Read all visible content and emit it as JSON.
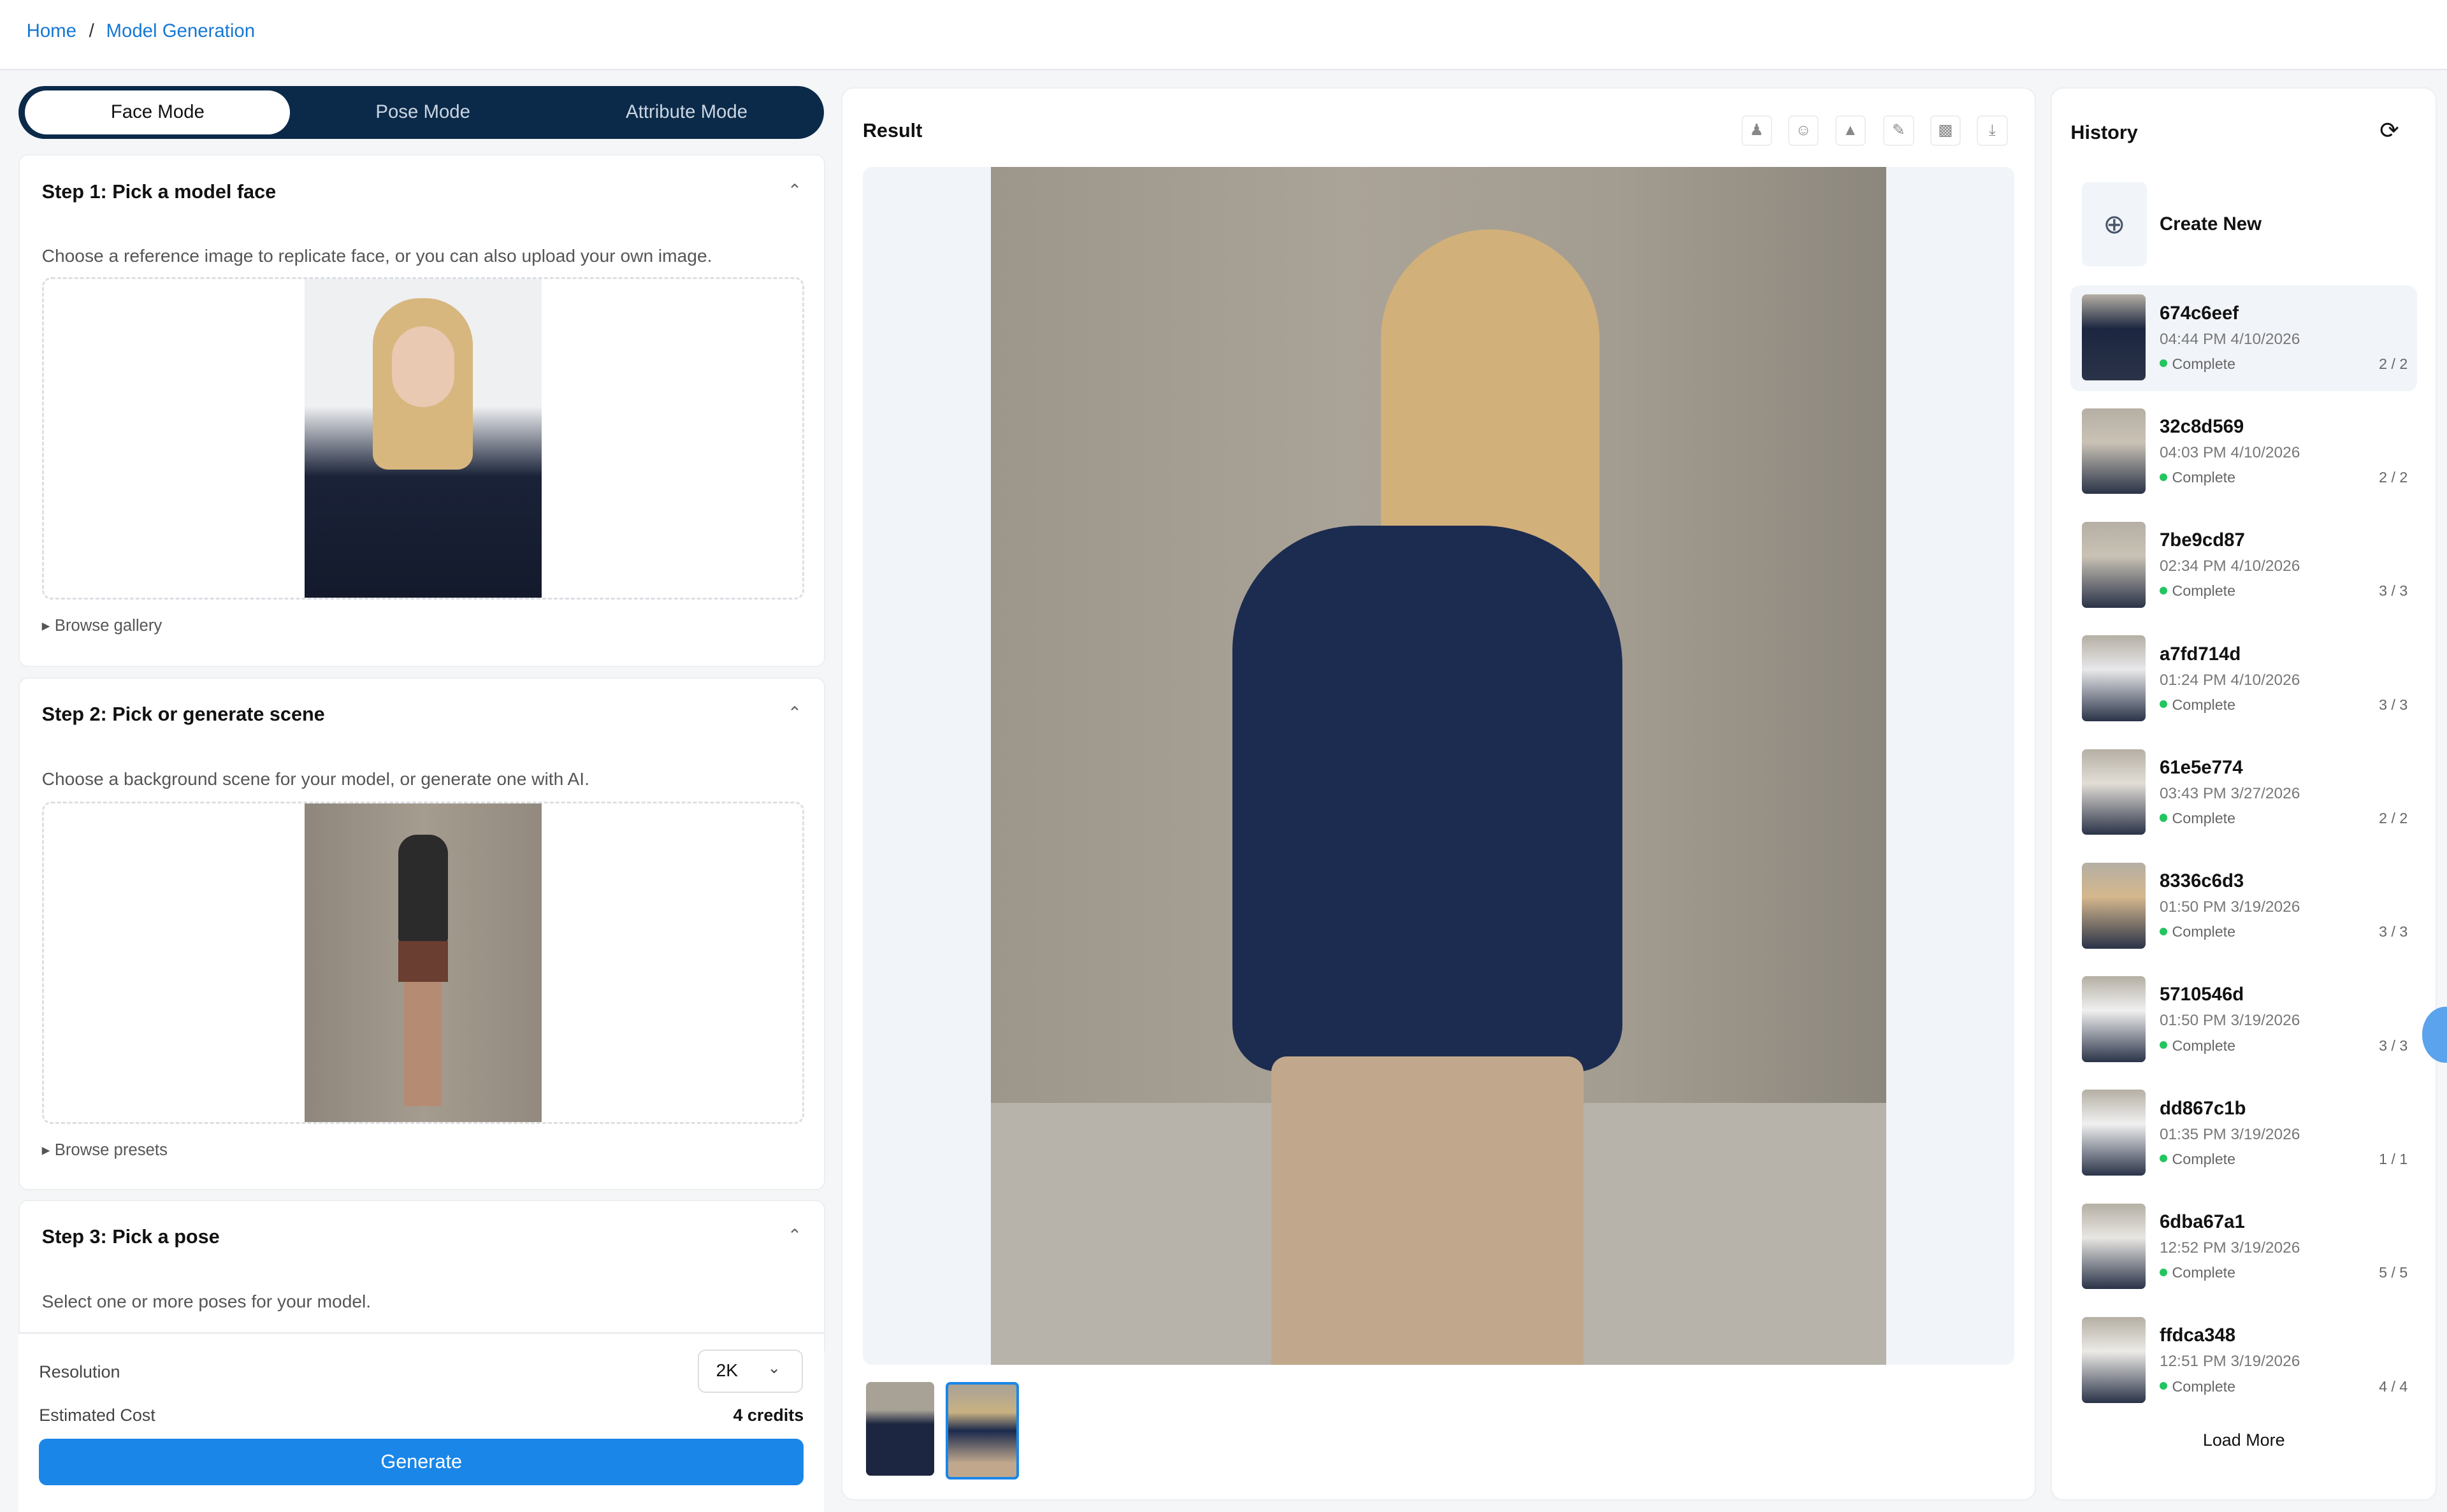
{
  "breadcrumb": {
    "home": "Home",
    "separator": "/",
    "current": "Model Generation"
  },
  "modes": [
    "Face Mode",
    "Pose Mode",
    "Attribute Mode"
  ],
  "steps": [
    {
      "title": "Step 1: Pick a model face",
      "desc": "Choose a reference image to replicate face, or you can also upload your own image.",
      "link": "Browse gallery"
    },
    {
      "title": "Step 2: Pick or generate scene",
      "desc": "Choose a background scene for your model, or generate one with AI.",
      "link": "Browse presets"
    },
    {
      "title": "Step 3: Pick a pose",
      "desc": "Select one or more poses for your model."
    }
  ],
  "settings": {
    "resolution_label": "Resolution",
    "resolution_value": "2K",
    "cost_label": "Estimated Cost",
    "cost_value": "4 credits",
    "generate": "Generate"
  },
  "result": {
    "title": "Result",
    "tools": [
      "pose-icon",
      "face-swap-icon",
      "scene-icon",
      "edit-icon",
      "upscale-icon",
      "download-icon"
    ]
  },
  "history": {
    "title": "History",
    "create_new": "Create New",
    "load_more": "Load More",
    "items": [
      {
        "id": "674c6eef",
        "time": "04:44 PM 4/10/2026",
        "status": "Complete",
        "count": "2 / 2"
      },
      {
        "id": "32c8d569",
        "time": "04:03 PM 4/10/2026",
        "status": "Complete",
        "count": "2 / 2"
      },
      {
        "id": "7be9cd87",
        "time": "02:34 PM 4/10/2026",
        "status": "Complete",
        "count": "3 / 3"
      },
      {
        "id": "a7fd714d",
        "time": "01:24 PM 4/10/2026",
        "status": "Complete",
        "count": "3 / 3"
      },
      {
        "id": "61e5e774",
        "time": "03:43 PM 3/27/2026",
        "status": "Complete",
        "count": "2 / 2"
      },
      {
        "id": "8336c6d3",
        "time": "01:50 PM 3/19/2026",
        "status": "Complete",
        "count": "3 / 3"
      },
      {
        "id": "5710546d",
        "time": "01:50 PM 3/19/2026",
        "status": "Complete",
        "count": "3 / 3"
      },
      {
        "id": "dd867c1b",
        "time": "01:35 PM 3/19/2026",
        "status": "Complete",
        "count": "1 / 1"
      },
      {
        "id": "6dba67a1",
        "time": "12:52 PM 3/19/2026",
        "status": "Complete",
        "count": "5 / 5"
      },
      {
        "id": "ffdca348",
        "time": "12:51 PM 3/19/2026",
        "status": "Complete",
        "count": "4 / 4"
      }
    ]
  }
}
